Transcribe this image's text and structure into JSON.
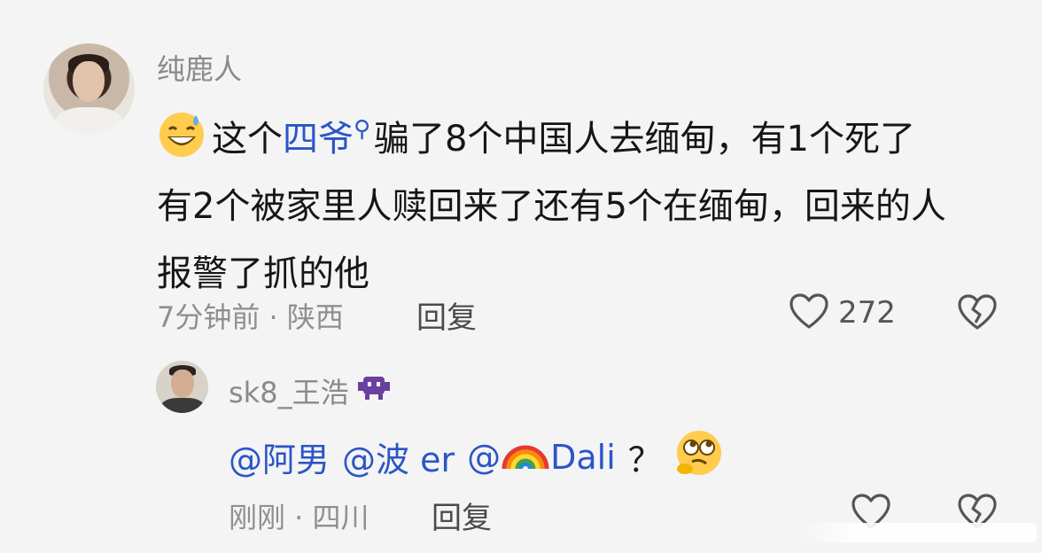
{
  "main_comment": {
    "username": "纯鹿人",
    "text_prefix": "这个",
    "mention": "四爷",
    "text_line1_rest": "骗了8个中国人去缅甸，有1个死了",
    "text_line2": "有2个被家里人赎回来了还有5个在缅甸，回来的人",
    "text_line3": "报警了抓的他",
    "meta": "7分钟前 · 陕西",
    "reply_label": "回复",
    "like_count": "272",
    "icons": {
      "emoji": "grinning-sweat-emoji",
      "search": "search-icon",
      "like": "heart-icon",
      "dislike": "broken-heart-icon"
    }
  },
  "reply_comment": {
    "username": "sk8_王浩",
    "badge_icon": "alien-monster-icon",
    "mentions": [
      "@阿男",
      "@波 er",
      "@",
      "Dali"
    ],
    "suffix": "？",
    "meta": "刚刚 · 四川",
    "reply_label": "回复",
    "icons": {
      "rainbow": "rainbow-icon",
      "thinking": "face-with-rolling-eyes-icon",
      "like": "heart-icon",
      "dislike": "broken-heart-icon"
    }
  },
  "colors": {
    "background": "#f4f4f4",
    "mention": "#2b55c8",
    "username": "#8a8a8a",
    "meta": "#8f8f8f",
    "monster": "#6b3fa0"
  }
}
